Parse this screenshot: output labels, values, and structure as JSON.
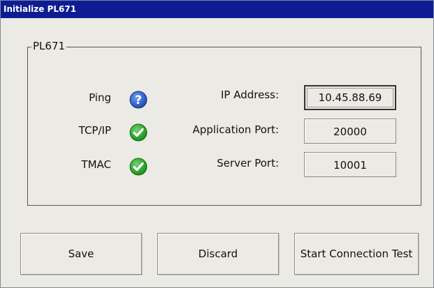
{
  "window": {
    "title": "Initialize PL671"
  },
  "group": {
    "label": "PL671"
  },
  "status": [
    {
      "label": "Ping",
      "icon": "question-icon",
      "color": "#1f5bc4"
    },
    {
      "label": "TCP/IP",
      "icon": "check-icon",
      "color": "#1f9a1f"
    },
    {
      "label": "TMAC",
      "icon": "check-icon",
      "color": "#1f9a1f"
    }
  ],
  "fields": {
    "ip_address": {
      "label": "IP Address:",
      "value": "10.45.88.69"
    },
    "application_port": {
      "label": "Application Port:",
      "value": "20000"
    },
    "server_port": {
      "label": "Server Port:",
      "value": "10001"
    }
  },
  "buttons": {
    "save": "Save",
    "discard": "Discard",
    "start_test": "Start Connection Test"
  },
  "colors": {
    "titlebar": "#0e1c93",
    "window_bg": "#eceae4"
  }
}
